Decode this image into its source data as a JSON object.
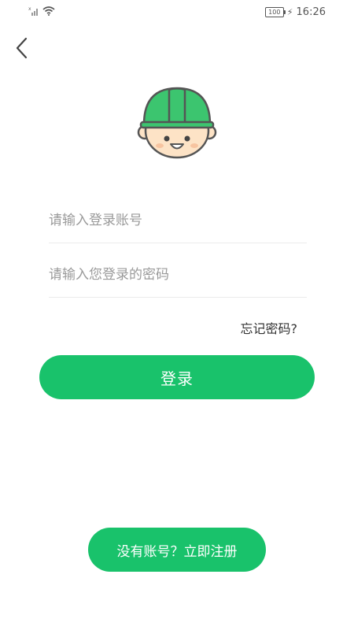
{
  "status_bar": {
    "battery": "100",
    "time": "16:26",
    "icons": [
      "signal-icon",
      "wifi-icon",
      "battery-icon",
      "charging-icon"
    ]
  },
  "header": {
    "back_icon": "chevron-left-icon"
  },
  "avatar": {
    "icon": "worker-helmet-avatar-icon",
    "helmet_color": "#3cc56f",
    "face_color": "#fde3c6"
  },
  "form": {
    "account_placeholder": "请输入登录账号",
    "password_placeholder": "请输入您登录的密码",
    "account_value": "",
    "password_value": ""
  },
  "forgot_password": "忘记密码?",
  "login_button": "登录",
  "register_button": "没有账号？立即注册",
  "colors": {
    "accent": "#19c26b",
    "divider": "#ebebeb"
  }
}
